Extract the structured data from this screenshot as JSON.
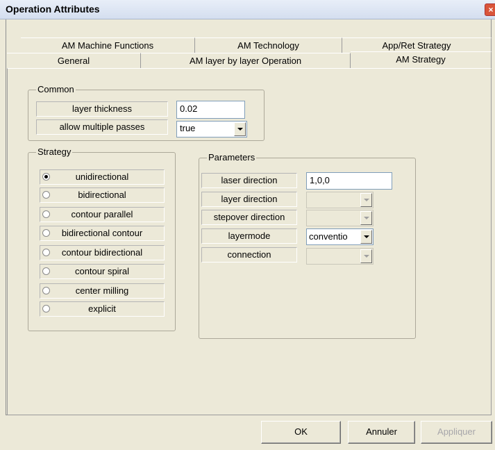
{
  "window": {
    "title": "Operation Attributes"
  },
  "tabs_row1": [
    {
      "label": "AM Machine Functions"
    },
    {
      "label": "AM Technology"
    },
    {
      "label": "App/Ret Strategy"
    }
  ],
  "tabs_row2": [
    {
      "label": "General"
    },
    {
      "label": "AM layer by layer Operation"
    },
    {
      "label": "AM Strategy",
      "selected": true
    }
  ],
  "common": {
    "title": "Common",
    "layer_thickness": {
      "label": "layer thickness",
      "value": "0.02"
    },
    "allow_multiple_passes": {
      "label": "allow multiple passes",
      "value": "true"
    }
  },
  "strategy": {
    "title": "Strategy",
    "options": [
      {
        "label": "unidirectional",
        "checked": true
      },
      {
        "label": "bidirectional",
        "checked": false
      },
      {
        "label": "contour parallel",
        "checked": false
      },
      {
        "label": "bidirectional contour",
        "checked": false
      },
      {
        "label": "contour bidirectional",
        "checked": false
      },
      {
        "label": "contour spiral",
        "checked": false
      },
      {
        "label": "center milling",
        "checked": false
      },
      {
        "label": "explicit",
        "checked": false
      }
    ]
  },
  "parameters": {
    "title": "Parameters",
    "rows": [
      {
        "label": "laser direction",
        "value": "1,0,0",
        "type": "text"
      },
      {
        "label": "layer direction",
        "value": "",
        "type": "combo",
        "disabled": true
      },
      {
        "label": "stepover direction",
        "value": "",
        "type": "combo",
        "disabled": true
      },
      {
        "label": "layermode",
        "value": "conventio",
        "type": "combo",
        "disabled": false
      },
      {
        "label": "connection",
        "value": "",
        "type": "combo",
        "disabled": true
      }
    ]
  },
  "buttons": {
    "ok": "OK",
    "cancel": "Annuler",
    "apply": "Appliquer"
  }
}
